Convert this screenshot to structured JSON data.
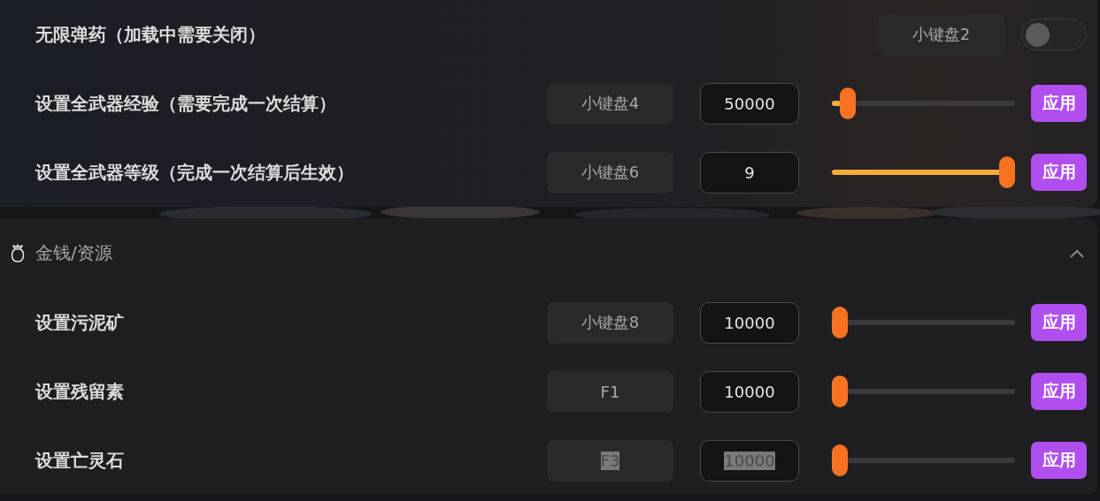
{
  "sections": [
    {
      "rows": [
        {
          "kind": "toggle",
          "label": "无限弹药（加载中需要关闭）",
          "hotkey": "小键盘2",
          "on": false
        },
        {
          "kind": "slider",
          "label": "设置全武器经验（需要完成一次结算）",
          "hotkey": "小键盘4",
          "value": "50000",
          "level": 0.05,
          "button": "应用",
          "text_selected": false
        },
        {
          "kind": "slider",
          "label": "设置全武器等级（完成一次结算后生效）",
          "hotkey": "小键盘6",
          "value": "9",
          "level": 1,
          "button": "应用",
          "text_selected": false
        }
      ]
    },
    {
      "title": "金钱/资源",
      "expanded": true,
      "rows": [
        {
          "kind": "slider",
          "label": "设置污泥矿",
          "hotkey": "小键盘8",
          "value": "10000",
          "level": 0,
          "button": "应用",
          "text_selected": false
        },
        {
          "kind": "slider",
          "label": "设置残留素",
          "hotkey": "F1",
          "value": "10000",
          "level": 0,
          "button": "应用",
          "text_selected": false
        },
        {
          "kind": "slider",
          "label": "设置亡灵石",
          "hotkey": "F3",
          "value": "10000",
          "level": 0,
          "button": "应用",
          "text_selected": true
        }
      ]
    }
  ]
}
